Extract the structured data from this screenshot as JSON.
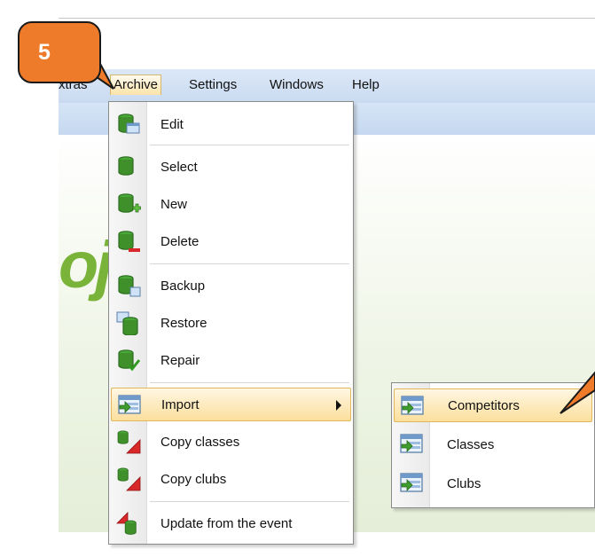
{
  "callout": {
    "number": "5"
  },
  "menubar": {
    "items": [
      {
        "label": "xtras"
      },
      {
        "label": "Archive"
      },
      {
        "label": "Settings"
      },
      {
        "label": "Windows"
      },
      {
        "label": "Help"
      }
    ]
  },
  "app": {
    "logo_fragment": "oj"
  },
  "archive_menu": {
    "items": [
      {
        "label": "Edit",
        "icon": "db-edit-icon"
      },
      {
        "label": "Select",
        "icon": "db-select-icon"
      },
      {
        "label": "New",
        "icon": "db-new-icon"
      },
      {
        "label": "Delete",
        "icon": "db-delete-icon"
      },
      {
        "label": "Backup",
        "icon": "db-backup-icon"
      },
      {
        "label": "Restore",
        "icon": "db-restore-icon"
      },
      {
        "label": "Repair",
        "icon": "db-repair-icon"
      },
      {
        "label": "Import",
        "icon": "import-icon"
      },
      {
        "label": "Copy classes",
        "icon": "copy-classes-icon"
      },
      {
        "label": "Copy clubs",
        "icon": "copy-clubs-icon"
      },
      {
        "label": "Update from the event",
        "icon": "update-event-icon"
      }
    ]
  },
  "import_submenu": {
    "items": [
      {
        "label": "Competitors",
        "icon": "import-competitors-icon"
      },
      {
        "label": "Classes",
        "icon": "import-classes-icon"
      },
      {
        "label": "Clubs",
        "icon": "import-clubs-icon"
      }
    ]
  },
  "colors": {
    "badge": "#ee7b2a",
    "highlight": "#fbdf9d",
    "db_green": "#3f8f2b",
    "logo_green": "#7ab339"
  }
}
